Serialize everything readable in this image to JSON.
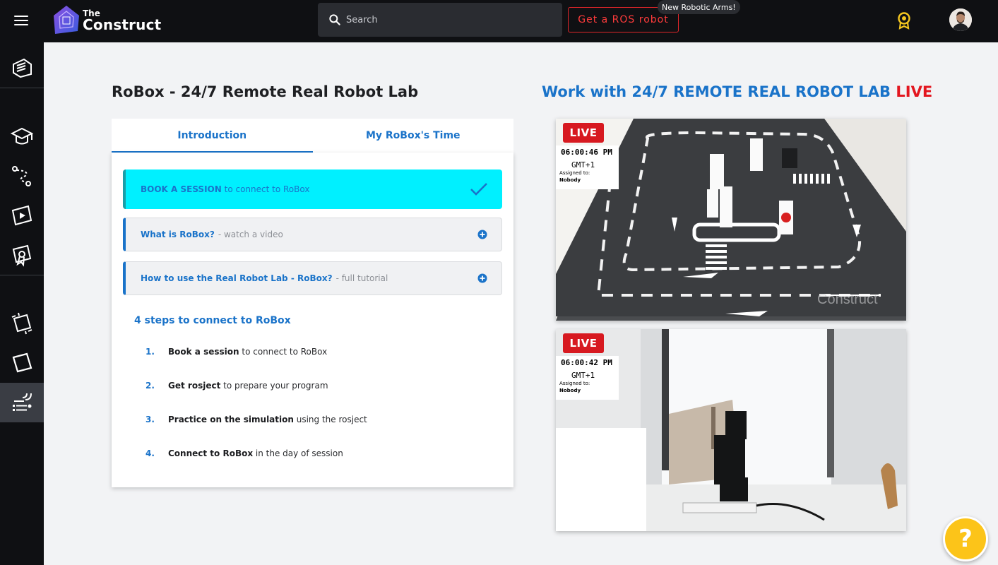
{
  "header": {
    "logo_top": "The",
    "logo_name": "Construct",
    "search_placeholder": "Search",
    "ros_button": "Get a ROS robot",
    "new_badge": "New Robotic Arms!"
  },
  "sidebar": {
    "items": [
      "courses",
      "academy",
      "learning-paths",
      "videos",
      "certifications",
      "rosjects",
      "notebooks",
      "real-robot-lab"
    ],
    "active": "real-robot-lab"
  },
  "main": {
    "title": "RoBox - 24/7 Remote Real Robot Lab",
    "tabs": [
      {
        "label": "Introduction",
        "active": true
      },
      {
        "label": "My RoBox's Time",
        "active": false
      }
    ],
    "book": {
      "label": "BOOK A SESSION",
      "suffix": " to connect to RoBox"
    },
    "accordions": [
      {
        "label": "What is RoBox?",
        "suffix": "- watch a video"
      },
      {
        "label": "How to use the Real Robot Lab - RoBox?",
        "suffix": "- full tutorial"
      }
    ],
    "steps_title": "4 steps to connect to RoBox",
    "steps": [
      {
        "num": "1.",
        "bold": "Book a session",
        "rest": " to connect to RoBox"
      },
      {
        "num": "2.",
        "bold": "Get rosject",
        "rest": " to prepare your program"
      },
      {
        "num": "3.",
        "bold": "Practice on the simulation",
        "rest": " using the rosject"
      },
      {
        "num": "4.",
        "bold": "Connect to RoBox",
        "rest": " in the day of session"
      }
    ]
  },
  "live": {
    "title": "Work with 24/7 REMOTE REAL ROBOT LAB ",
    "title_live": "LIVE",
    "cams": [
      {
        "badge": "LIVE",
        "time": "06:00:46 PM",
        "tz": "GMT+1",
        "assigned": "Assigned to:",
        "who": "Nobody"
      },
      {
        "badge": "LIVE",
        "time": "06:00:42 PM",
        "tz": "GMT+1",
        "assigned": "Assigned to:",
        "who": "Nobody"
      }
    ]
  },
  "help": {
    "label": "?"
  },
  "colors": {
    "accent": "#1a73c9",
    "book_bg": "#00f0ff",
    "live_red": "#e3161f",
    "help": "#fcc419",
    "dark": "#0f1013"
  }
}
